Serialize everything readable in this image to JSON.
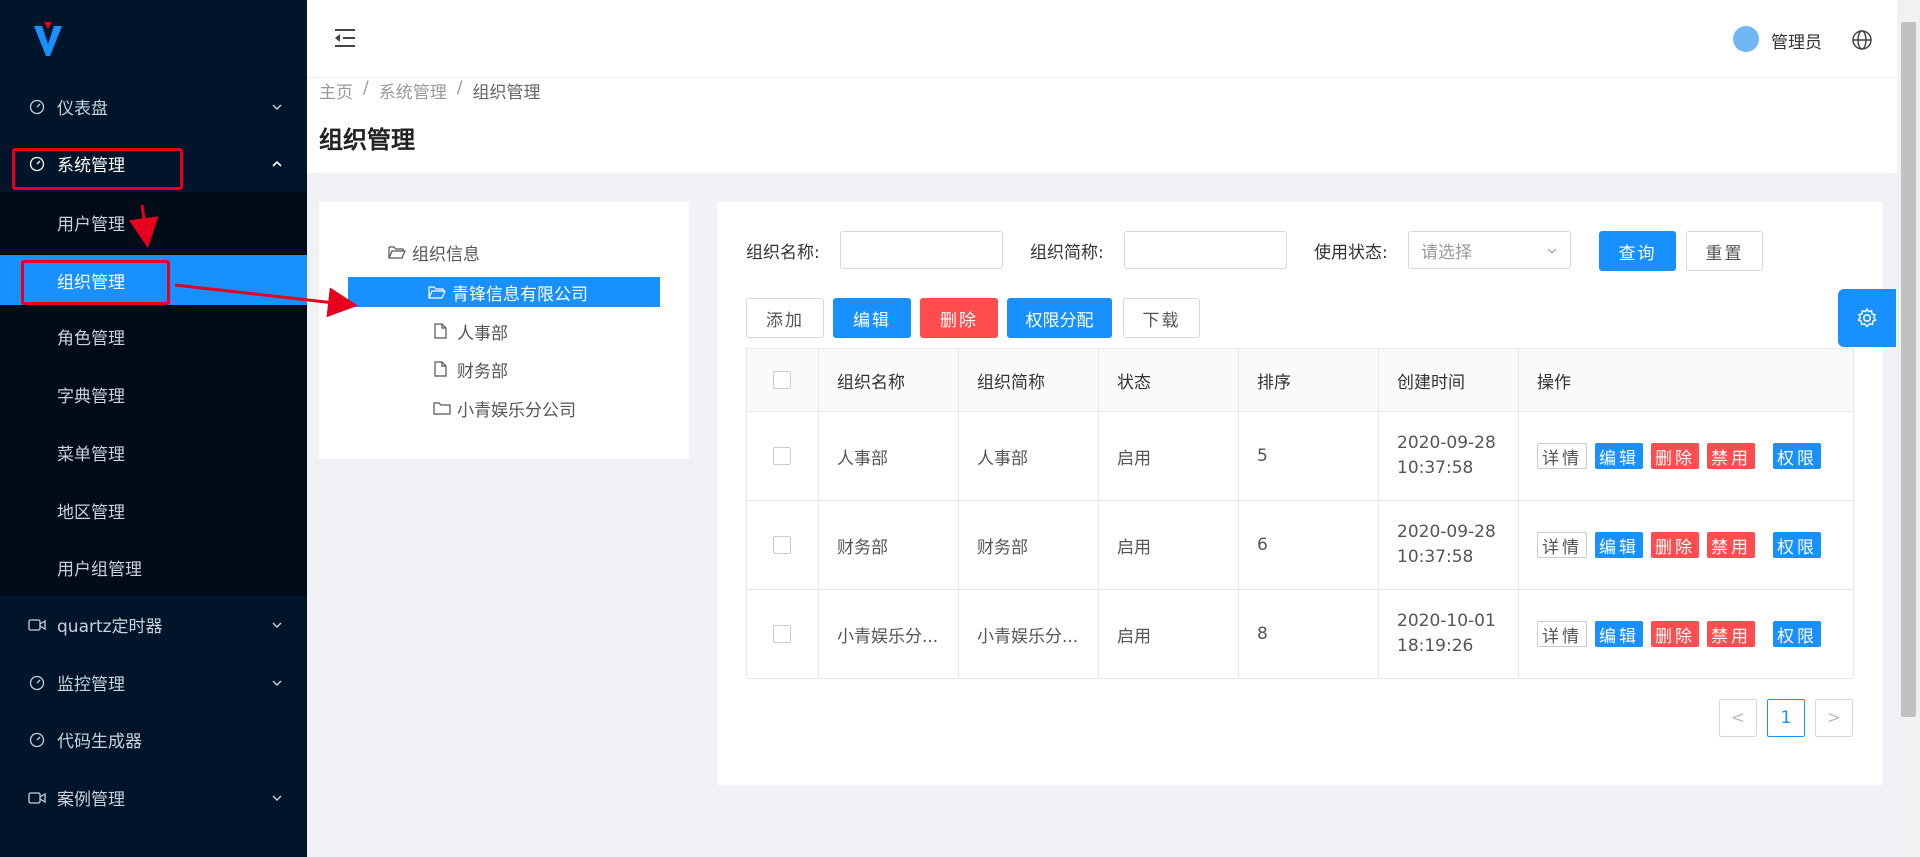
{
  "sidebar": {
    "menu": [
      {
        "label": "仪表盘",
        "icon": "dashboard-icon"
      },
      {
        "label": "系统管理",
        "icon": "dashboard-icon"
      },
      {
        "label": "quartz定时器",
        "icon": "video-icon"
      },
      {
        "label": "监控管理",
        "icon": "dashboard-icon"
      },
      {
        "label": "代码生成器",
        "icon": "dashboard-icon"
      },
      {
        "label": "案例管理",
        "icon": "video-icon"
      }
    ],
    "submenu": [
      {
        "label": "用户管理"
      },
      {
        "label": "组织管理"
      },
      {
        "label": "角色管理"
      },
      {
        "label": "字典管理"
      },
      {
        "label": "菜单管理"
      },
      {
        "label": "地区管理"
      },
      {
        "label": "用户组管理"
      }
    ]
  },
  "header": {
    "user_name": "管理员"
  },
  "breadcrumb": {
    "items": [
      "主页",
      "系统管理",
      "组织管理"
    ],
    "sep": "/"
  },
  "page_title": "组织管理",
  "tree": {
    "root": "组织信息",
    "company": "青锋信息有限公司",
    "children": [
      "人事部",
      "财务部",
      "小青娱乐分公司"
    ]
  },
  "filters": {
    "name_label": "组织名称:",
    "short_label": "组织简称:",
    "status_label": "使用状态:",
    "status_placeholder": "请选择",
    "query_button": "查询",
    "reset_button": "重置"
  },
  "toolbar": {
    "add": "添加",
    "edit": "编辑",
    "delete": "删除",
    "permission": "权限分配",
    "download": "下载"
  },
  "table": {
    "columns": [
      "组织名称",
      "组织简称",
      "状态",
      "排序",
      "创建时间",
      "操作"
    ],
    "rows": [
      {
        "name": "人事部",
        "short": "人事部",
        "status": "启用",
        "order": "5",
        "date": "2020-09-28",
        "time": "10:37:58"
      },
      {
        "name": "财务部",
        "short": "财务部",
        "status": "启用",
        "order": "6",
        "date": "2020-09-28",
        "time": "10:37:58"
      },
      {
        "name": "小青娱乐分...",
        "short": "小青娱乐分...",
        "status": "启用",
        "order": "8",
        "date": "2020-10-01",
        "time": "18:19:26"
      }
    ],
    "ops": {
      "detail": "详情",
      "edit": "编辑",
      "delete": "删除",
      "disable": "禁用",
      "perm": "权限"
    }
  },
  "pagination": {
    "current": "1",
    "prev": "<",
    "next": ">"
  },
  "colors": {
    "sidebar_bg": "#001529",
    "primary": "#1890ff",
    "danger": "#ff4d4f",
    "annotation": "#e6001e"
  }
}
